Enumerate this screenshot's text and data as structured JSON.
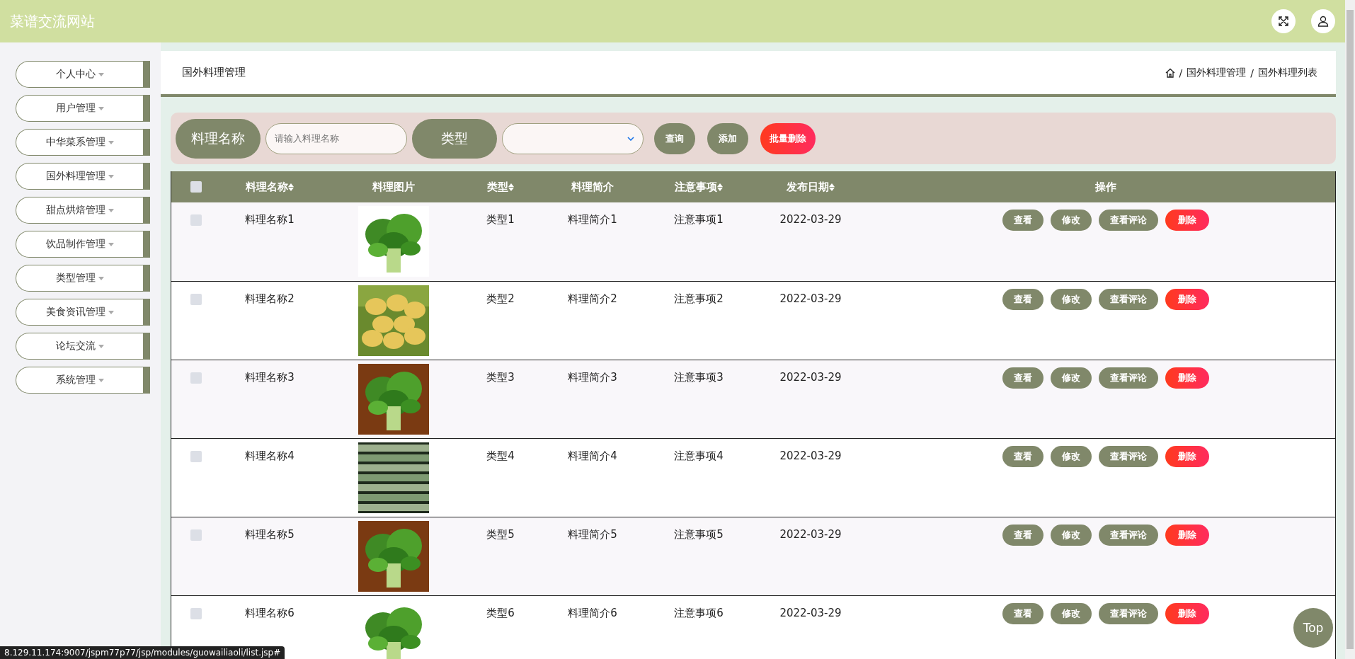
{
  "header": {
    "title": "菜谱交流网站"
  },
  "sidebar": {
    "items": [
      {
        "label": "个人中心"
      },
      {
        "label": "用户管理"
      },
      {
        "label": "中华菜系管理"
      },
      {
        "label": "国外料理管理"
      },
      {
        "label": "甜点烘焙管理"
      },
      {
        "label": "饮品制作管理"
      },
      {
        "label": "类型管理"
      },
      {
        "label": "美食资讯管理"
      },
      {
        "label": "论坛交流"
      },
      {
        "label": "系统管理"
      }
    ]
  },
  "breadcrumb": {
    "title": "国外料理管理",
    "separator": "/",
    "path": [
      "国外料理管理",
      "国外料理列表"
    ]
  },
  "filters": [
    {
      "kind": "text",
      "label": "料理名称",
      "placeholder": "请输入料理名称"
    },
    {
      "kind": "select",
      "label": "类型"
    }
  ],
  "buttons": [
    {
      "kind": "primary",
      "label": "查询"
    },
    {
      "kind": "primary",
      "label": "添加"
    },
    {
      "kind": "danger",
      "label": "批量删除"
    }
  ],
  "table": {
    "select_all": {
      "checked": false
    },
    "columns": [
      {
        "label": "料理名称",
        "sortable": true
      },
      {
        "label": "料理图片",
        "sortable": false
      },
      {
        "label": "类型",
        "sortable": true
      },
      {
        "label": "料理简介",
        "sortable": false
      },
      {
        "label": "注意事项",
        "sortable": true
      },
      {
        "label": "发布日期",
        "sortable": true
      },
      {
        "label": "操作",
        "sortable": false
      }
    ],
    "rows": [
      {
        "checked": false,
        "name": "料理名称1",
        "type": "类型1",
        "intro": "料理简介1",
        "note": "注意事项1",
        "date": "2022-03-29",
        "actions": [
          {
            "kind": "primary",
            "label": "查看"
          },
          {
            "kind": "primary",
            "label": "修改"
          },
          {
            "kind": "primary",
            "label": "查看评论"
          },
          {
            "kind": "danger",
            "label": "删除"
          }
        ]
      },
      {
        "checked": false,
        "name": "料理名称2",
        "type": "类型2",
        "intro": "料理简介2",
        "note": "注意事项2",
        "date": "2022-03-29",
        "actions": [
          {
            "kind": "primary",
            "label": "查看"
          },
          {
            "kind": "primary",
            "label": "修改"
          },
          {
            "kind": "primary",
            "label": "查看评论"
          },
          {
            "kind": "danger",
            "label": "删除"
          }
        ]
      },
      {
        "checked": false,
        "name": "料理名称3",
        "type": "类型3",
        "intro": "料理简介3",
        "note": "注意事项3",
        "date": "2022-03-29",
        "actions": [
          {
            "kind": "primary",
            "label": "查看"
          },
          {
            "kind": "primary",
            "label": "修改"
          },
          {
            "kind": "primary",
            "label": "查看评论"
          },
          {
            "kind": "danger",
            "label": "删除"
          }
        ]
      },
      {
        "checked": false,
        "name": "料理名称4",
        "type": "类型4",
        "intro": "料理简介4",
        "note": "注意事项4",
        "date": "2022-03-29",
        "actions": [
          {
            "kind": "primary",
            "label": "查看"
          },
          {
            "kind": "primary",
            "label": "修改"
          },
          {
            "kind": "primary",
            "label": "查看评论"
          },
          {
            "kind": "danger",
            "label": "删除"
          }
        ]
      },
      {
        "checked": false,
        "name": "料理名称5",
        "type": "类型5",
        "intro": "料理简介5",
        "note": "注意事项5",
        "date": "2022-03-29",
        "actions": [
          {
            "kind": "primary",
            "label": "查看"
          },
          {
            "kind": "primary",
            "label": "修改"
          },
          {
            "kind": "primary",
            "label": "查看评论"
          },
          {
            "kind": "danger",
            "label": "删除"
          }
        ]
      },
      {
        "checked": false,
        "name": "料理名称6",
        "type": "类型6",
        "intro": "料理简介6",
        "note": "注意事项6",
        "date": "2022-03-29",
        "actions": [
          {
            "kind": "primary",
            "label": "查看"
          },
          {
            "kind": "primary",
            "label": "修改"
          },
          {
            "kind": "primary",
            "label": "查看评论"
          },
          {
            "kind": "danger",
            "label": "删除"
          }
        ]
      }
    ]
  },
  "back_to_top": "Top",
  "status_url": "8.129.11.174:9007/jspm77p77/jsp/modules/guowailiaoli/list.jsp#"
}
